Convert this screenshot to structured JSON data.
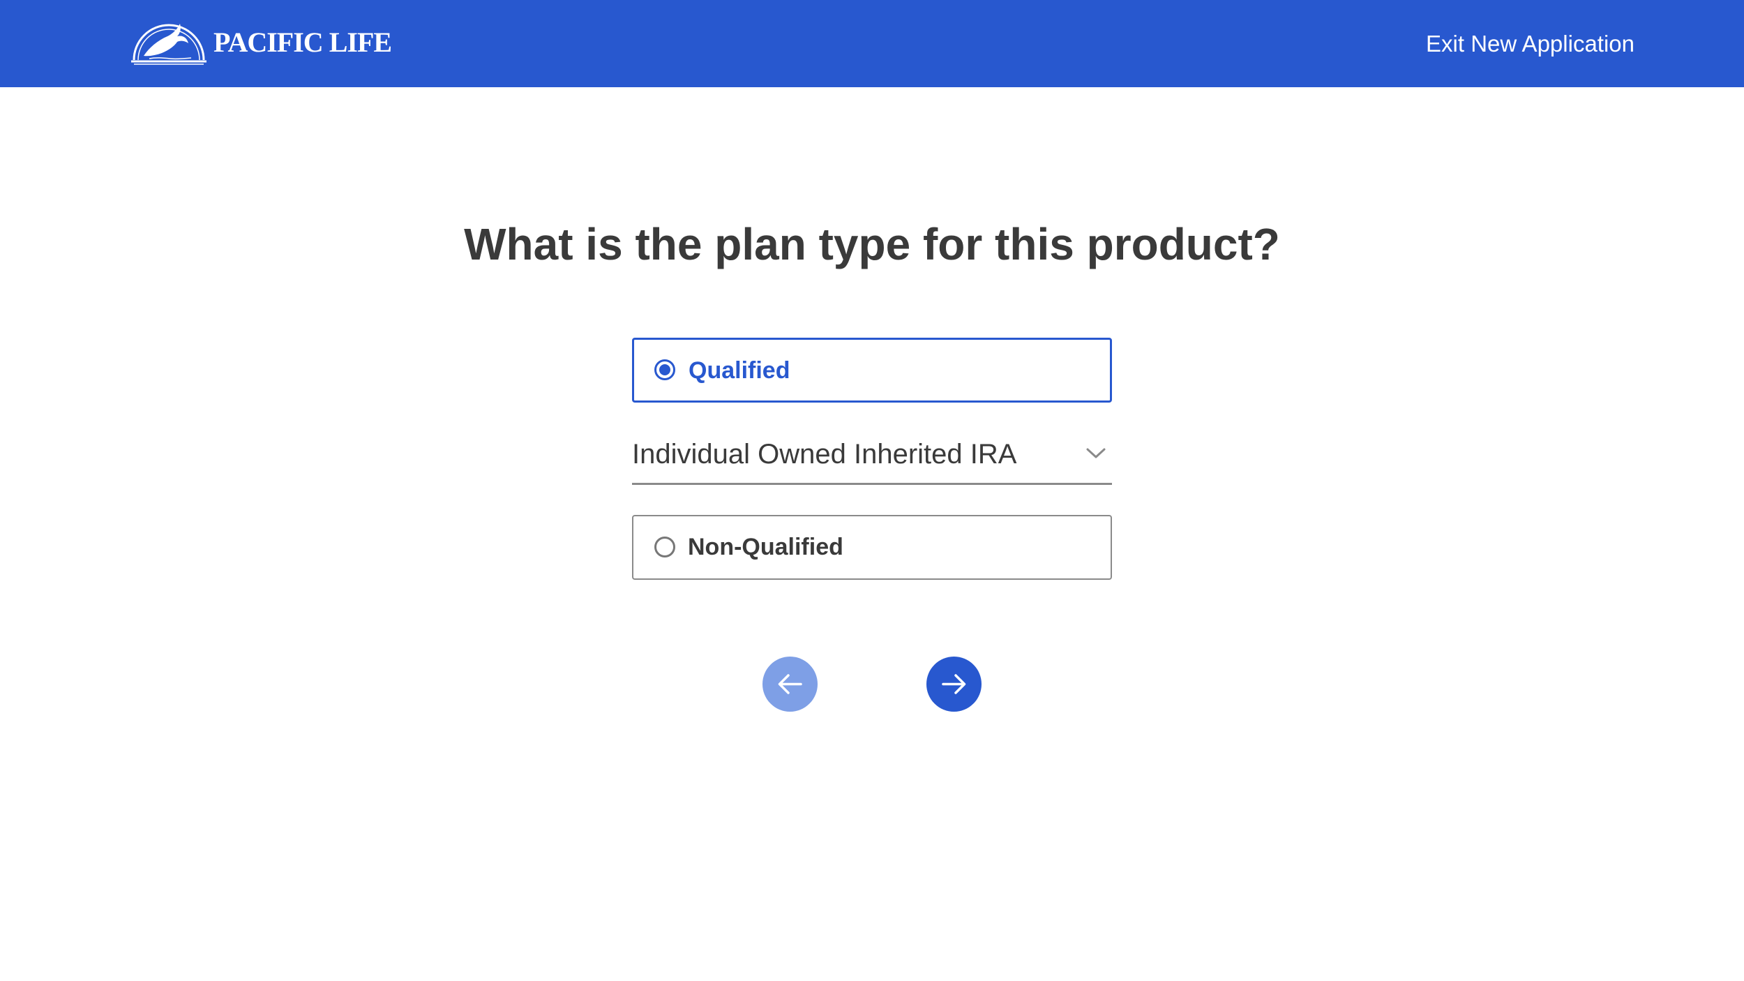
{
  "header": {
    "logo_text": "PACIFIC LIFE",
    "exit_label": "Exit New Application",
    "background_color": "#2858cf"
  },
  "main": {
    "question": "What is the plan type for this product?",
    "options": [
      {
        "label": "Qualified",
        "selected": true
      },
      {
        "label": "Non-Qualified",
        "selected": false
      }
    ],
    "plan_select": {
      "value": "Individual Owned Inherited IRA",
      "icon": "chevron-down-icon"
    },
    "navigation": {
      "back_icon": "arrow-left-icon",
      "next_icon": "arrow-right-icon"
    }
  },
  "colors": {
    "accent": "#2858cf",
    "back_button": "#7e9fe6",
    "text": "#3a3a3a"
  }
}
